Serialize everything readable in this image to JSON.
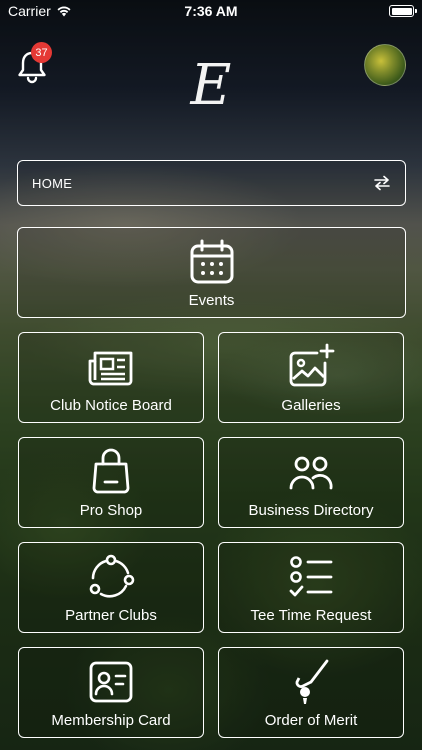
{
  "status_bar": {
    "carrier": "Carrier",
    "time": "7:36 AM"
  },
  "header": {
    "notification_count": "37",
    "logo_letter": "E"
  },
  "nav": {
    "current": "HOME"
  },
  "tiles": [
    {
      "label": "Events",
      "icon": "calendar-icon"
    },
    {
      "label": "Club Notice Board",
      "icon": "newspaper-icon"
    },
    {
      "label": "Galleries",
      "icon": "gallery-add-icon"
    },
    {
      "label": "Pro Shop",
      "icon": "shopping-bag-icon"
    },
    {
      "label": "Business Directory",
      "icon": "people-icon"
    },
    {
      "label": "Partner Clubs",
      "icon": "network-icon"
    },
    {
      "label": "Tee Time Request",
      "icon": "checklist-icon"
    },
    {
      "label": "Membership Card",
      "icon": "id-card-icon"
    },
    {
      "label": "Order of Merit",
      "icon": "golf-club-icon"
    }
  ]
}
